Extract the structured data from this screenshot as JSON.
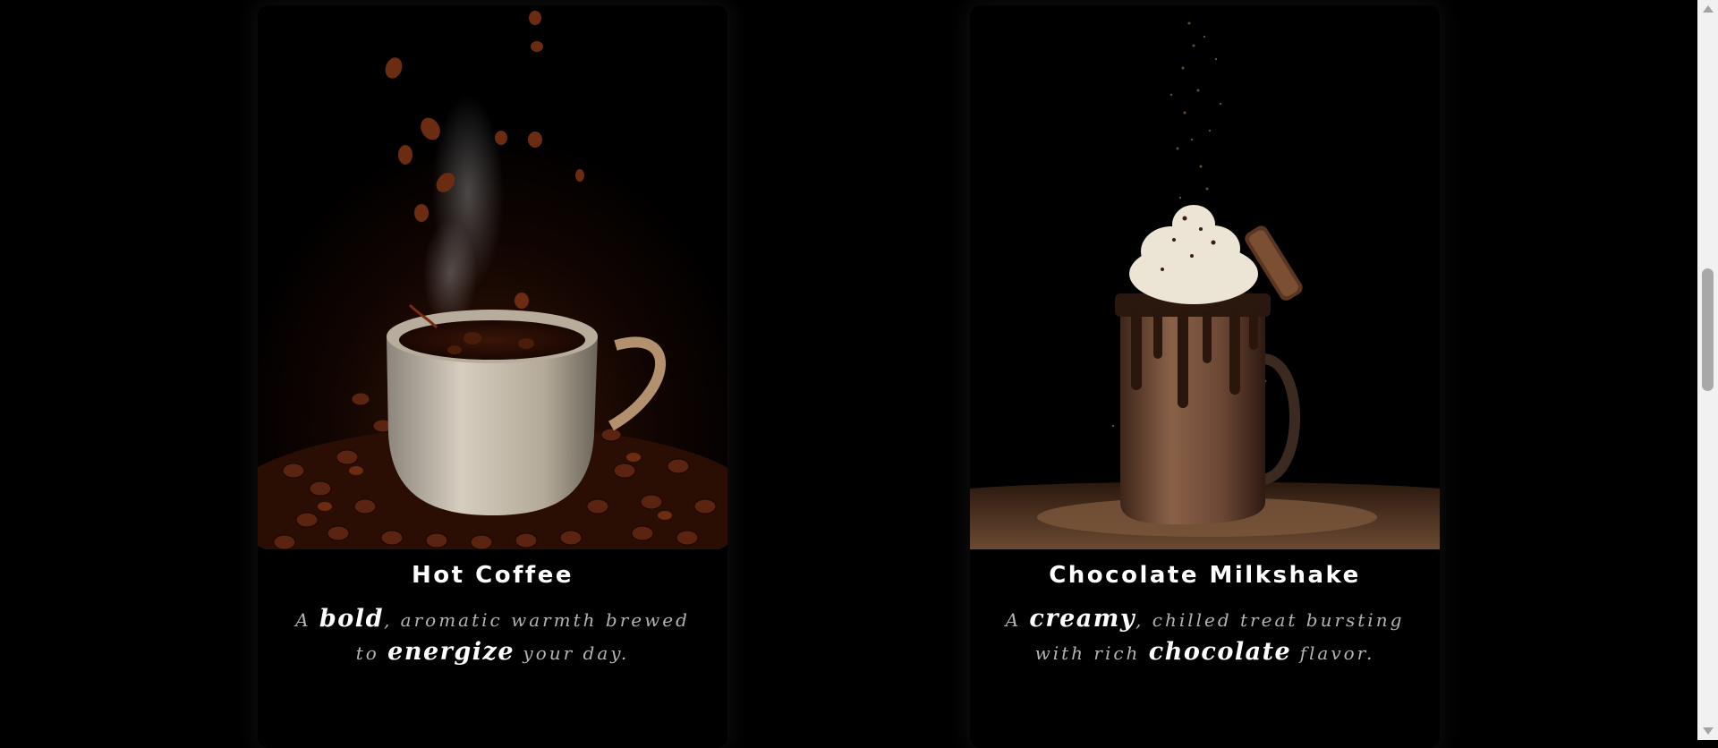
{
  "cards": [
    {
      "title": "Hot Coffee",
      "desc": {
        "a": "A",
        "b": "bold",
        "c": ", aromatic warmth brewed to",
        "d": "energize",
        "e": "your day."
      },
      "image_icon": "coffee-cup-photo"
    },
    {
      "title": "Chocolate Milkshake",
      "desc": {
        "a": "A",
        "b": "creamy",
        "c": ", chilled treat bursting with rich",
        "d": "chocolate",
        "e": "flavor."
      },
      "image_icon": "milkshake-photo"
    }
  ],
  "colors": {
    "background": "#000000",
    "title": "#ffffff",
    "description": "#b3b3b3",
    "scrollbar_track": "#f1f1f1",
    "scrollbar_thumb": "#a8a8a8"
  },
  "scrollbar": {
    "position_fraction": 0.36
  }
}
